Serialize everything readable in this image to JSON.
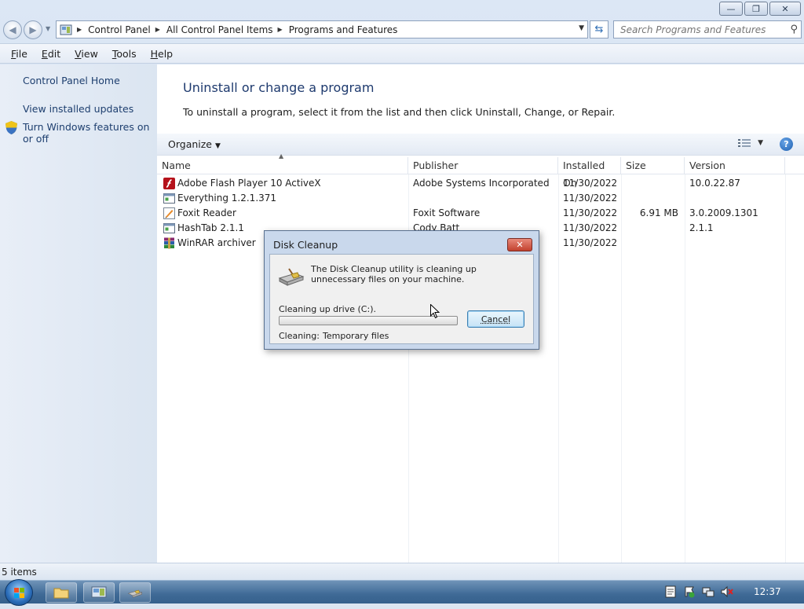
{
  "window": {
    "controls": {
      "minimize": "—",
      "maximize": "❐",
      "close": "✕"
    }
  },
  "nav": {
    "breadcrumbs": [
      "Control Panel",
      "All Control Panel Items",
      "Programs and Features"
    ],
    "search_placeholder": "Search Programs and Features"
  },
  "menu": {
    "items": [
      {
        "acc": "F",
        "rest": "ile"
      },
      {
        "acc": "E",
        "rest": "dit"
      },
      {
        "acc": "V",
        "rest": "iew"
      },
      {
        "acc": "T",
        "rest": "ools"
      },
      {
        "acc": "H",
        "rest": "elp"
      }
    ]
  },
  "sidebar": {
    "home": "Control Panel Home",
    "updates": "View installed updates",
    "features": "Turn Windows features on or off"
  },
  "main": {
    "title": "Uninstall or change a program",
    "subtitle": "To uninstall a program, select it from the list and then click Uninstall, Change, or Repair.",
    "organize": "Organize",
    "columns": [
      "Name",
      "Publisher",
      "Installed On",
      "Size",
      "Version"
    ],
    "rows": [
      {
        "name": "Adobe Flash Player 10 ActiveX",
        "publisher": "Adobe Systems Incorporated",
        "date": "11/30/2022",
        "size": "",
        "version": "10.0.22.87",
        "icon": "flash-icon"
      },
      {
        "name": "Everything 1.2.1.371",
        "publisher": "",
        "date": "11/30/2022",
        "size": "",
        "version": "",
        "icon": "generic-program-icon"
      },
      {
        "name": "Foxit Reader",
        "publisher": "Foxit Software",
        "date": "11/30/2022",
        "size": "6.91 MB",
        "version": "3.0.2009.1301",
        "icon": "foxit-icon"
      },
      {
        "name": "HashTab 2.1.1",
        "publisher": "Cody Batt",
        "date": "11/30/2022",
        "size": "",
        "version": "2.1.1",
        "icon": "generic-program-icon"
      },
      {
        "name": "WinRAR archiver",
        "publisher": "",
        "date": "11/30/2022",
        "size": "",
        "version": "",
        "icon": "winrar-icon"
      }
    ]
  },
  "status": {
    "count": "5 items"
  },
  "dialog": {
    "title": "Disk Cleanup",
    "message": "The Disk Cleanup utility is cleaning up unnecessary files on your machine.",
    "drive_label": "Cleaning up drive  (C:).",
    "progress": 0,
    "cancel": "Cancel",
    "status_label": "Cleaning:",
    "status_value": "Temporary files"
  },
  "taskbar": {
    "clock": "12:37"
  }
}
